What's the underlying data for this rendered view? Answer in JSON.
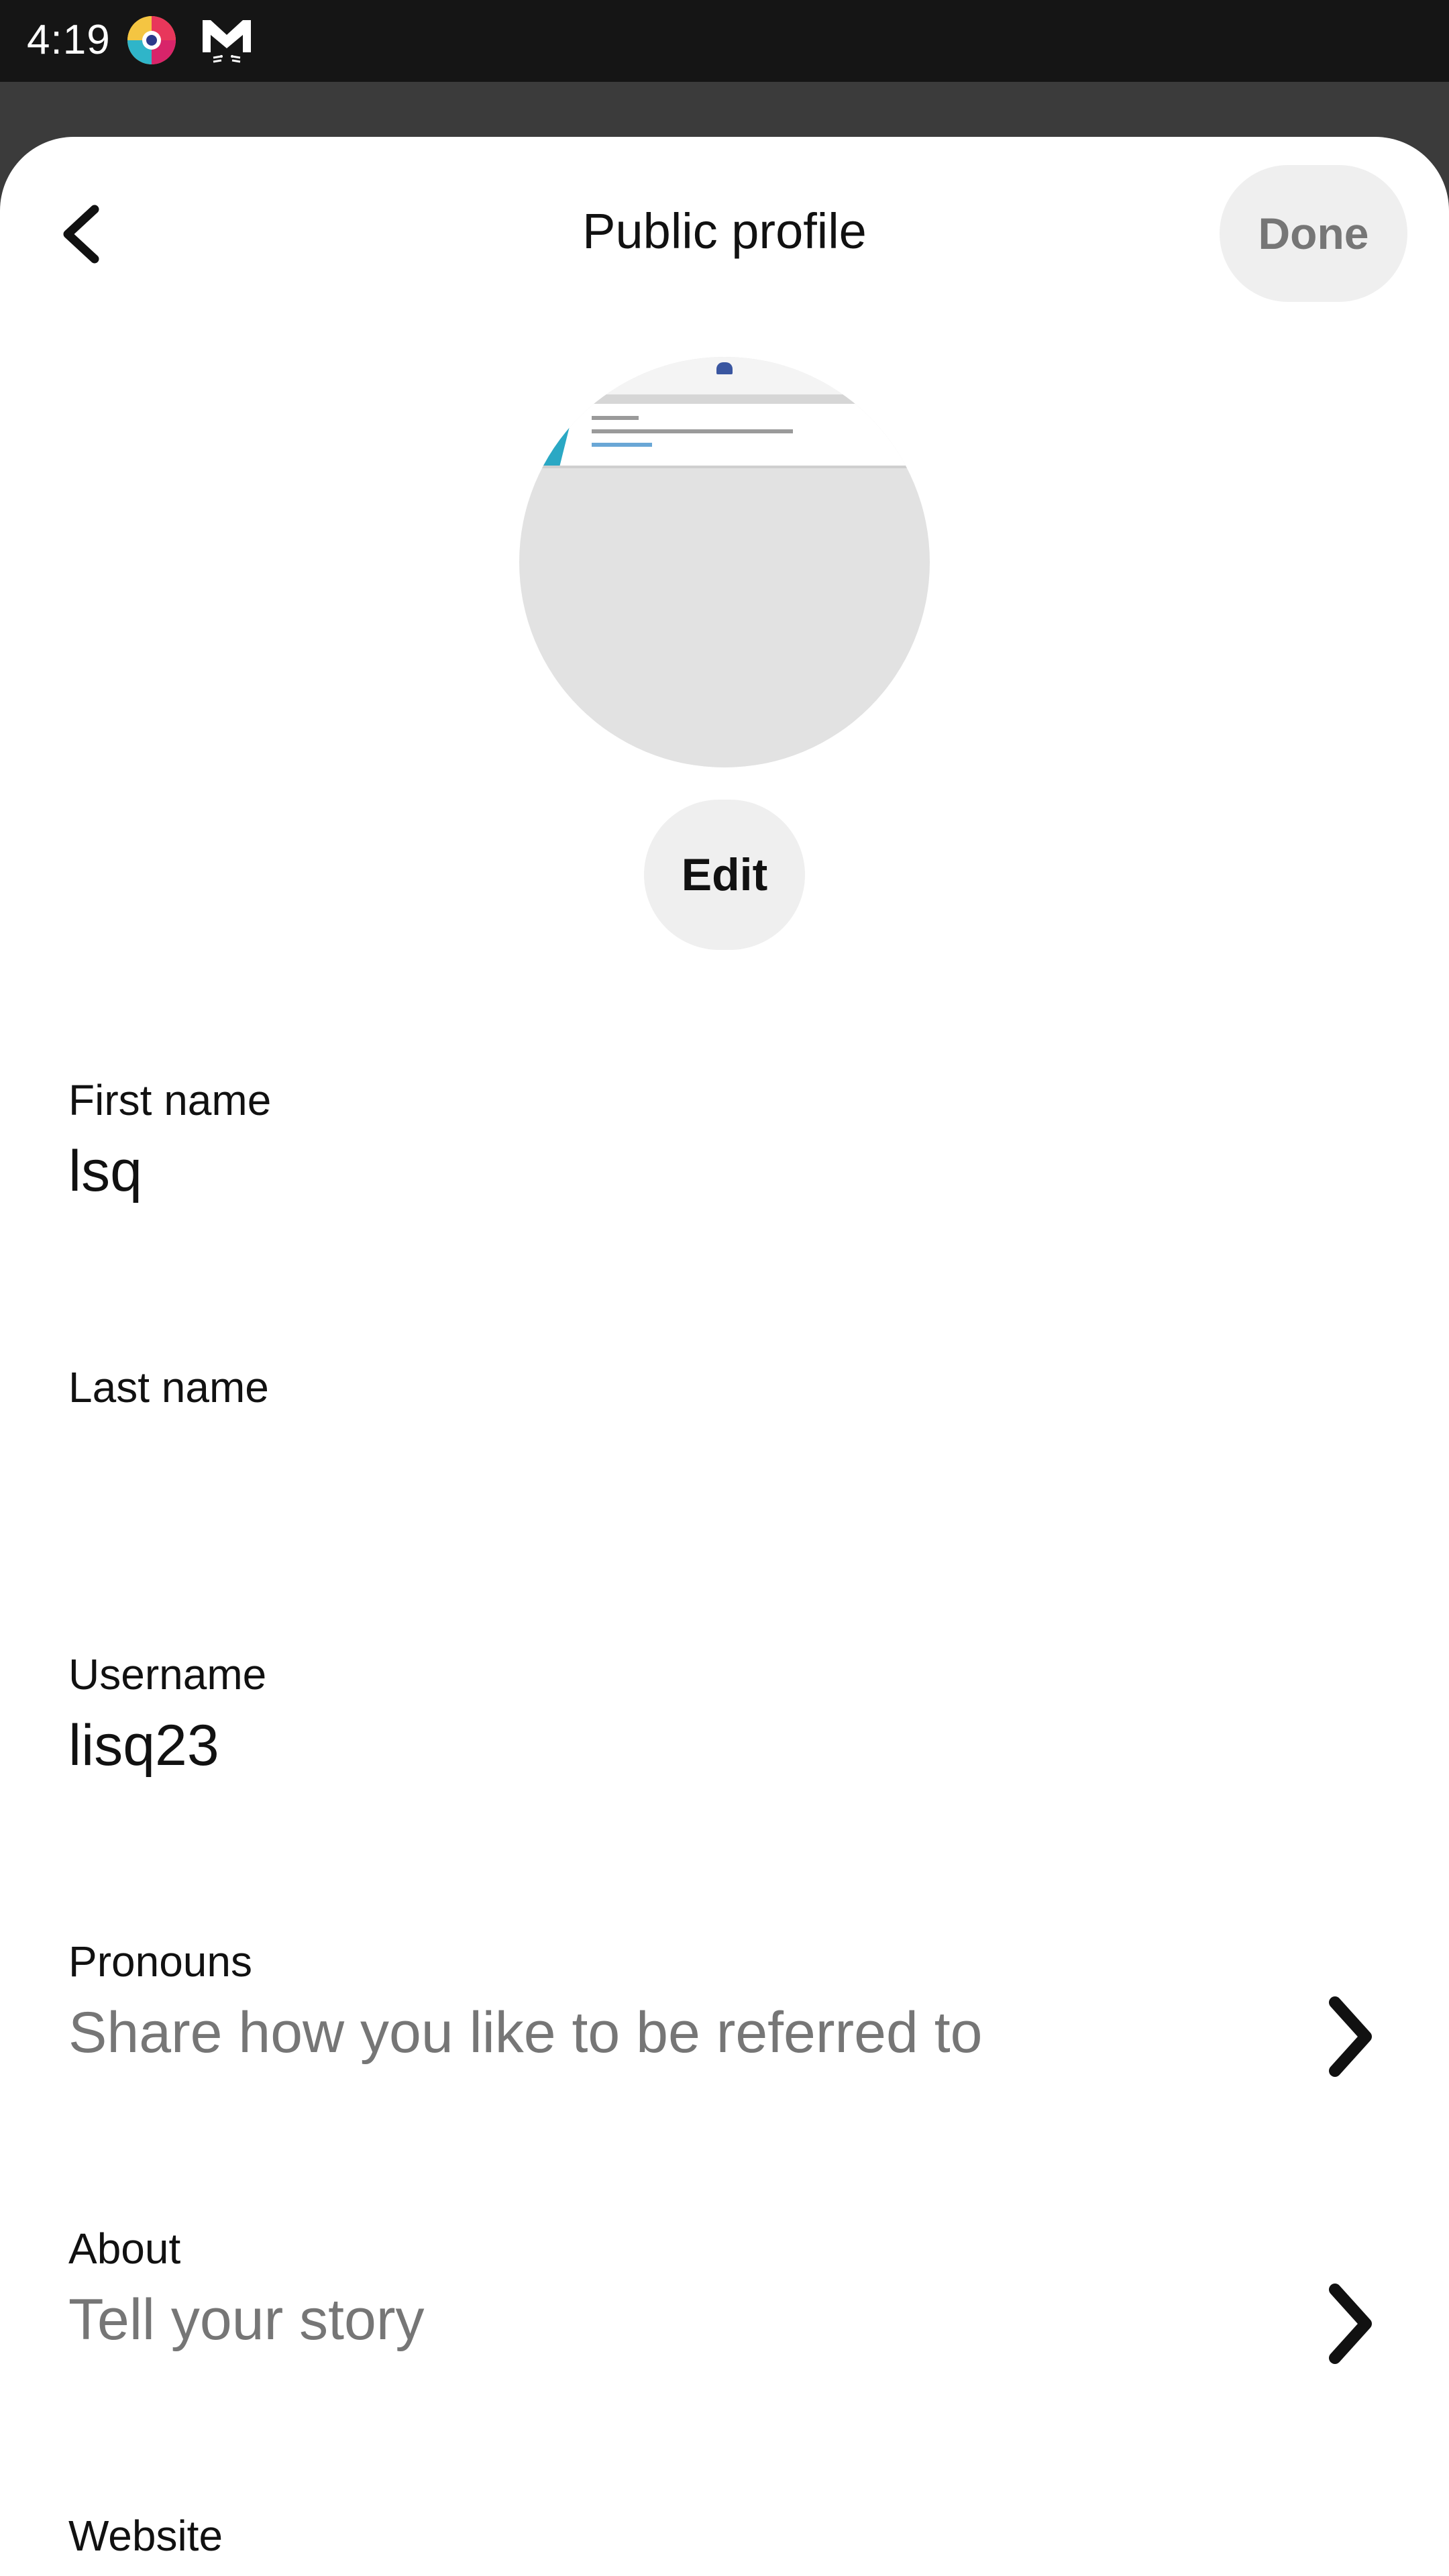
{
  "status_bar": {
    "time": "4:19"
  },
  "header": {
    "title": "Public profile",
    "done_label": "Done",
    "back_icon": "chevron-left-icon"
  },
  "avatar": {
    "edit_label": "Edit"
  },
  "fields": {
    "first_name": {
      "label": "First name",
      "value": "lsq"
    },
    "last_name": {
      "label": "Last name",
      "value": ""
    },
    "username": {
      "label": "Username",
      "value": "lisq23"
    },
    "pronouns": {
      "label": "Pronouns",
      "placeholder": "Share how you like to be referred to"
    },
    "about": {
      "label": "About",
      "placeholder": "Tell your story"
    },
    "website": {
      "label": "Website"
    }
  },
  "colors": {
    "status_bar": "#151515",
    "sheet": "#ffffff",
    "button_bg": "#efefef",
    "disabled_text": "#767676",
    "text": "#111111"
  }
}
